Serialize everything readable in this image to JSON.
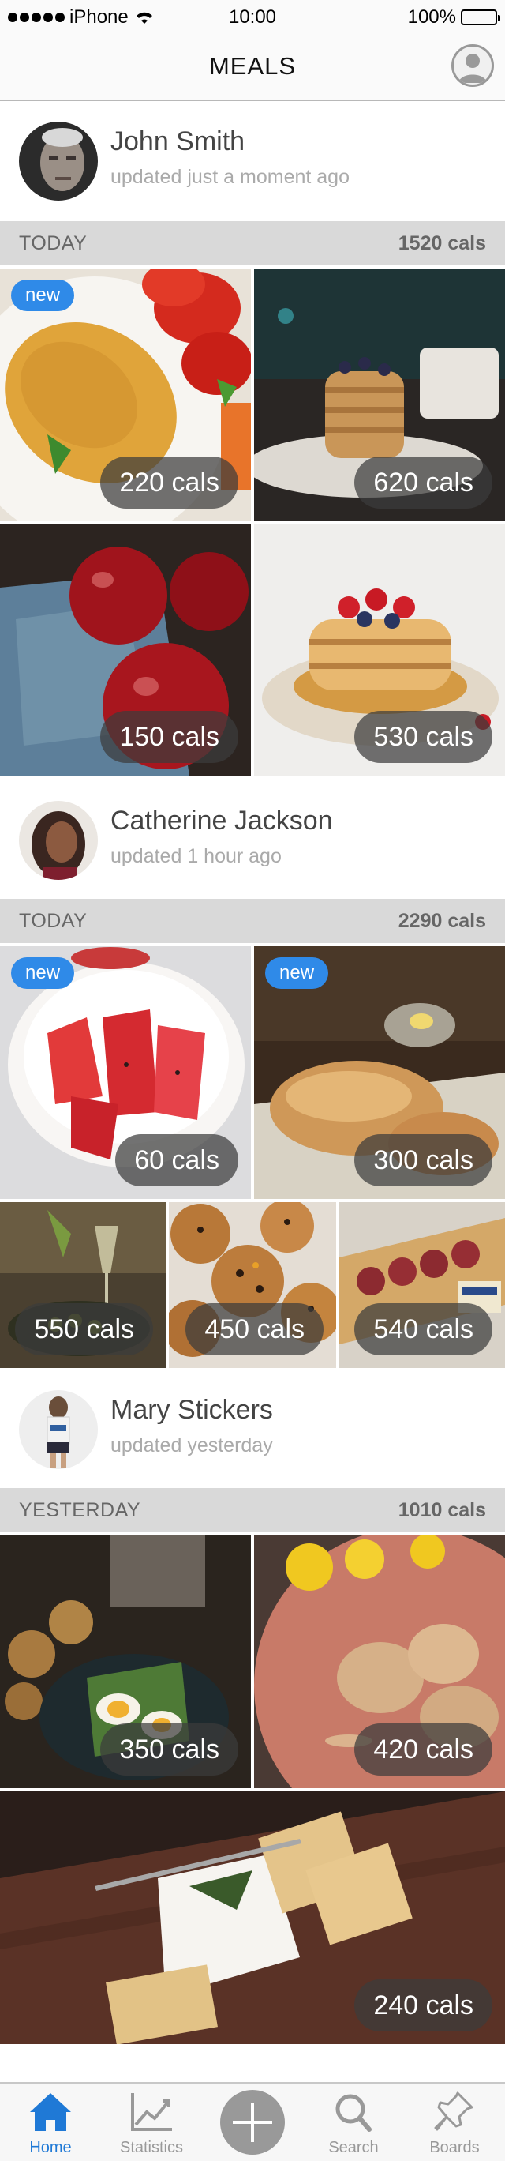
{
  "status": {
    "carrier": "iPhone",
    "time": "10:00",
    "battery": "100%"
  },
  "nav": {
    "title": "MEALS"
  },
  "feed": [
    {
      "user": {
        "name": "John Smith",
        "updated": "updated just a moment ago"
      },
      "section": {
        "day": "TODAY",
        "cals": "1520 cals"
      },
      "meals": [
        {
          "cals": "220 cals",
          "new": "new",
          "description": "omelette with tomatoes"
        },
        {
          "cals": "620 cals",
          "description": "pancakes with blueberries"
        },
        {
          "cals": "150 cals",
          "description": "red apples"
        },
        {
          "cals": "530 cals",
          "description": "pancakes with strawberries"
        }
      ]
    },
    {
      "user": {
        "name": "Catherine Jackson",
        "updated": "updated 1 hour ago"
      },
      "section": {
        "day": "TODAY",
        "cals": "2290 cals"
      },
      "meals": [
        {
          "cals": "60 cals",
          "new": "new",
          "description": "watermelon"
        },
        {
          "cals": "300 cals",
          "new": "new",
          "description": "bread"
        },
        {
          "cals": "550 cals",
          "description": "wine and olives"
        },
        {
          "cals": "450 cals",
          "description": "cookies"
        },
        {
          "cals": "540 cals",
          "description": "sausage sandwich"
        }
      ]
    },
    {
      "user": {
        "name": "Mary Stickers",
        "updated": "updated yesterday"
      },
      "section": {
        "day": "YESTERDAY",
        "cals": "1010 cals"
      },
      "meals": [
        {
          "cals": "350 cals",
          "description": "eggs and salad"
        },
        {
          "cals": "420 cals",
          "description": "pastries"
        },
        {
          "cals": "240 cals",
          "description": "cheese and crackers"
        }
      ]
    }
  ],
  "tabs": [
    {
      "label": "Home",
      "icon": "home-icon",
      "active": true
    },
    {
      "label": "Statistics",
      "icon": "chart-icon"
    },
    {
      "label": "",
      "icon": "plus-icon"
    },
    {
      "label": "Search",
      "icon": "search-icon"
    },
    {
      "label": "Boards",
      "icon": "pin-icon"
    }
  ],
  "colors": {
    "accent": "#1f79d6",
    "badge": "#2f8ae8",
    "section": "#d9d9d9"
  }
}
